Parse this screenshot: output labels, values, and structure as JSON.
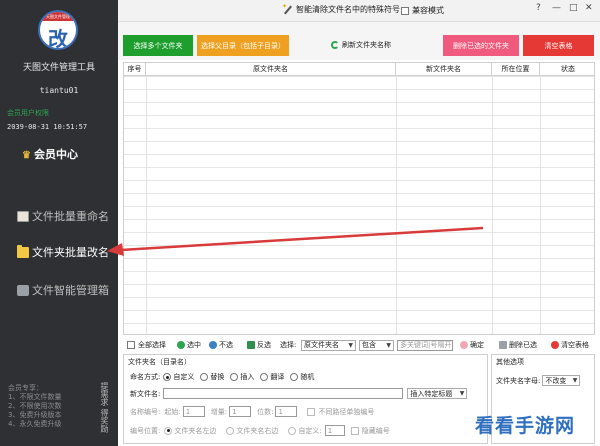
{
  "sidebar": {
    "logo_char": "改",
    "logo_banner": "天图文件管理",
    "app_title": "天图文件管理工具",
    "username": "tiantu01",
    "member_label": "会员用户权限",
    "expiry": "2039-08-31 10:51:57",
    "member_center": "会员中心",
    "nav": [
      {
        "label": "文件批量重命名",
        "icon": "file-icon"
      },
      {
        "label": "文件夹批量改名",
        "icon": "folder-icon"
      },
      {
        "label": "文件智能管理箱",
        "icon": "box-icon"
      }
    ],
    "support_lines": [
      "会员专享：",
      "1、不限文件数量",
      "2、不限使用次数",
      "3、免费升级版本",
      "4、永久免费升级"
    ],
    "vertical_text": "提需求 得奖励"
  },
  "topbar": {
    "smart_label": "智能清除文件名中的特殊符号",
    "compat_label": "兼容模式",
    "controls": [
      "?",
      "—",
      "□",
      "✕"
    ]
  },
  "toolbar": {
    "select_multi": "选择多个文件夹",
    "select_parent": "选择父目录（包括子目录）",
    "refresh": "刷新文件夹名称",
    "delete_selected": "删除已选的文件夹",
    "clear_table": "清空表格"
  },
  "table": {
    "headers": [
      "序号",
      "原文件夹名",
      "新文件夹名",
      "所在位置",
      "状态"
    ]
  },
  "selection": {
    "select_all": "全部选择",
    "check": "选中",
    "uncheck": "不选",
    "invert": "反选",
    "select_label": "选择:",
    "field": "原文件夹名",
    "match": "包含",
    "keyword_placeholder": "多关键词|号隔开",
    "confirm": "确定",
    "delete_selected": "删除已选",
    "clear_table": "清空表格"
  },
  "rename": {
    "title": "文件夹名（目录名）",
    "mode_label": "命名方式:",
    "modes": [
      "自定义",
      "替换",
      "插入",
      "翻译",
      "随机"
    ],
    "new_name_label": "新文件名:",
    "insert_option": "插入特定标题",
    "num_label": "名称编号:",
    "start_label": "起始:",
    "start_value": "1",
    "inc_label": "增量:",
    "inc_value": "1",
    "digits_label": "位数:",
    "digits_value": "1",
    "separate_label": "不同路径单独编号",
    "pos_label": "编号位置:",
    "positions": [
      "文件夹名左边",
      "文件夹名右边",
      "自定义:"
    ],
    "custom_value": "1",
    "hide_label": "隐藏编号"
  },
  "other": {
    "title": "其他选项",
    "case_label": "文件夹名字母:",
    "case_value": "不改变"
  },
  "watermark": "看看手游网"
}
